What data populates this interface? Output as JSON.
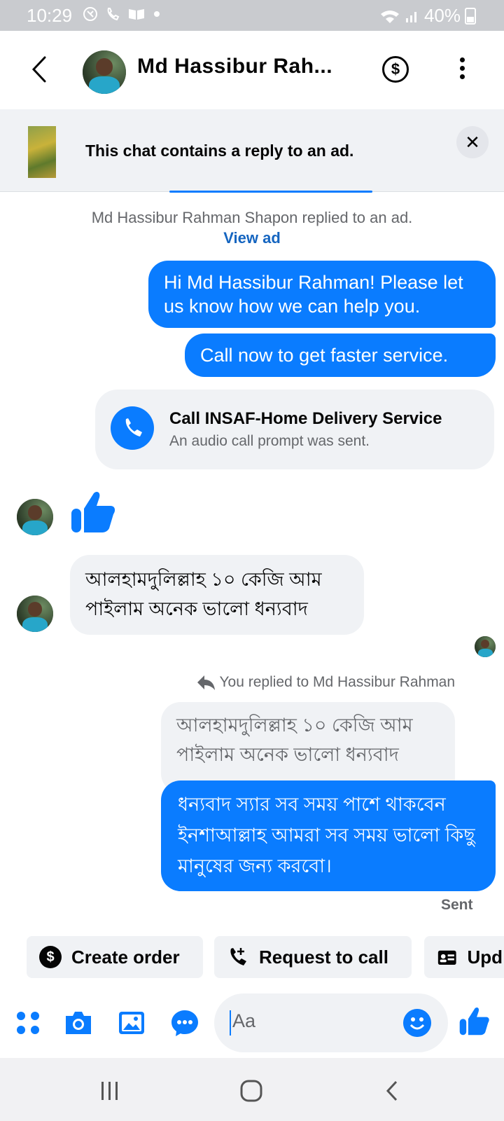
{
  "status_bar": {
    "time": "10:29",
    "battery": "40%"
  },
  "header": {
    "title": "Md Hassibur Rah...",
    "dollar_label": "$"
  },
  "ad_banner": {
    "text": "This chat contains a reply to an ad.",
    "close_label": "✕"
  },
  "notice": {
    "text": "Md Hassibur Rahman Shapon replied to an ad. ",
    "link": "View ad"
  },
  "messages": {
    "greeting": "Hi Md Hassibur Rahman! Please let us know how we can help you.",
    "call_now": "Call now to get faster service.",
    "call_card_title": "Call INSAF-Home Delivery Service",
    "call_card_sub": "An audio call prompt was sent.",
    "customer_msg": "আলহামদুলিল্লাহ ১০ কেজি আম পাইলাম অনেক ভালো ধন্যবাদ",
    "reply_label": "You replied to Md Hassibur Rahman",
    "quoted_msg": "আলহামদুলিল্লাহ ১০ কেজি আম পাইলাম অনেক ভালো ধন্যবাদ",
    "reply_msg": "ধন্যবাদ স্যার সব সময় পাশে থাকবেন ইনশাআল্লাহ আমরা সব সময় ভালো কিছু মানুষের জন্য করবো।",
    "sent_status": "Sent"
  },
  "quick_actions": {
    "create_order": "Create order",
    "request_call": "Request to call",
    "update": "Upd"
  },
  "composer": {
    "placeholder": "Aa"
  },
  "colors": {
    "accent": "#0a7cff",
    "bubble_in": "#f0f2f5"
  },
  "icons": [
    "back-icon",
    "dollar-icon",
    "more-icon",
    "close-icon",
    "phone-icon",
    "thumbs-up-icon",
    "reply-arrow-icon",
    "menu-dots-icon",
    "camera-icon",
    "gallery-icon",
    "chat-bubble-icon",
    "emoji-icon"
  ]
}
